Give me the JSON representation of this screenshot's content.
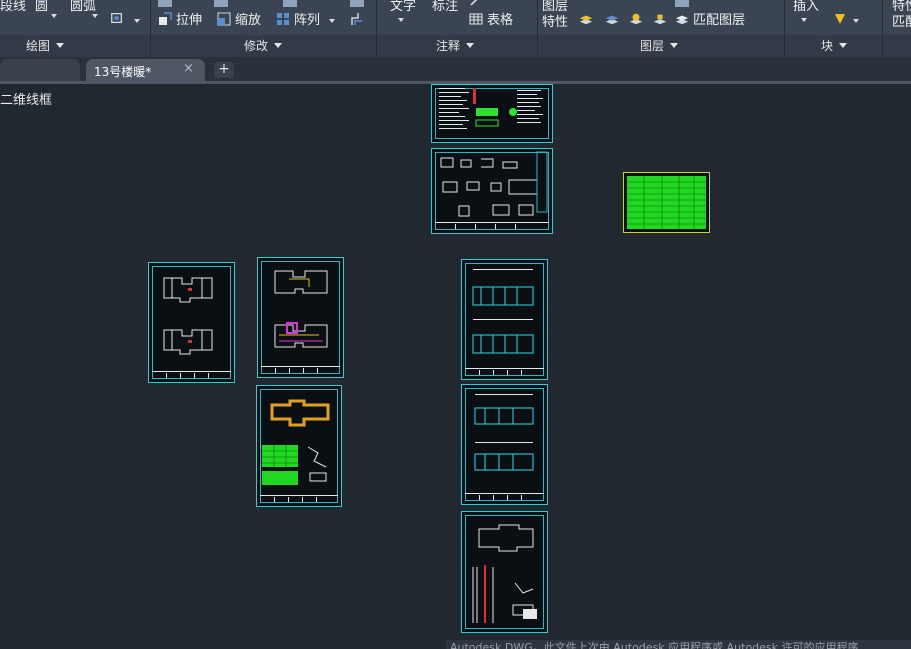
{
  "ribbon": {
    "draw_panel": {
      "polyline": "段线",
      "circle": "圆",
      "arc": "圆弧",
      "label": "绘图"
    },
    "modify_panel": {
      "stretch": "拉伸",
      "scale": "缩放",
      "array": "阵列",
      "label": "修改"
    },
    "annotation_panel": {
      "text": "文字",
      "dimension": "标注",
      "table": "表格",
      "label": "注释"
    },
    "layers_panel": {
      "layer": "图层",
      "properties": "特性",
      "match_layer": "匹配图层",
      "label": "图层"
    },
    "block_panel": {
      "insert": "插入",
      "label": "块"
    },
    "properties_panel": {
      "properties": "特性",
      "match": "匹配"
    }
  },
  "tabs": {
    "active_file": "13号楼暖*",
    "close_glyph": "×",
    "new_tab_glyph": "+"
  },
  "viewport": {
    "view_label": "二维线框"
  },
  "status_text": "Autodesk DWG。此文件上次由 Autodesk 应用程序或 Autodesk 许可的应用程序",
  "colors": {
    "ribbon_bg": "#3b4453",
    "canvas_bg": "#212830",
    "sheet_frame": "#27d2d6",
    "drawing_green": "#2fe02f",
    "drawing_magenta": "#e02fe0",
    "drawing_yellow": "#e0c020",
    "drawing_cyan": "#33d9e8"
  }
}
